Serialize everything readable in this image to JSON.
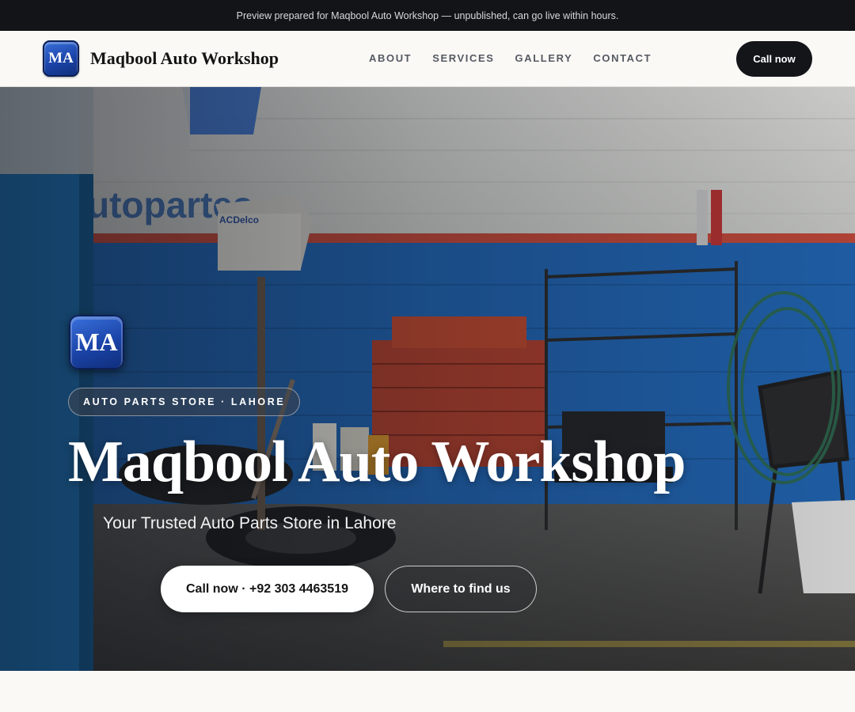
{
  "preview_banner": {
    "text": "Preview prepared for Maqbool Auto Workshop — unpublished, can go live within hours."
  },
  "navbar": {
    "logo_text": "MA",
    "brand": "Maqbool Auto Workshop",
    "links": [
      "ABOUT",
      "SERVICES",
      "GALLERY",
      "CONTACT"
    ],
    "cta_label": "Call now"
  },
  "hero": {
    "logo_text": "MA",
    "badge": "AUTO PARTS STORE · LAHORE",
    "title": "Maqbool Auto Workshop",
    "subtitle": "Your Trusted Auto Parts Store in Lahore",
    "primary_button": "Call now · +92 303 4463519",
    "secondary_button": "Where to find us",
    "background_sign_text": "utopartes",
    "background_box_label": "ACDelco"
  },
  "colors": {
    "top_bar": "#121418",
    "nav_background": "#faf9f6",
    "logo_blue": "#1b44a8",
    "cta_dark": "#141519"
  }
}
